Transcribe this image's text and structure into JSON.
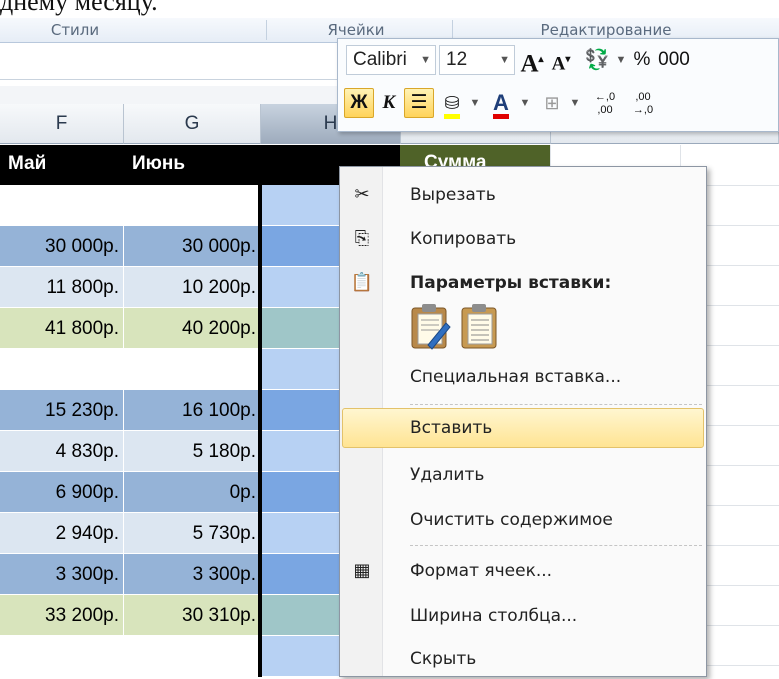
{
  "top_text": "днему месяцу.",
  "ribbon": {
    "groups": [
      "Стили",
      "Ячейки",
      "Редактирование"
    ]
  },
  "columns": [
    "F",
    "G",
    "H"
  ],
  "table_header": {
    "F": "Май",
    "G": "Июнь",
    "I": "Сумма"
  },
  "rows": [
    {
      "f": "",
      "g": "",
      "bg": "#ffffff",
      "hbg": "#b7d1f3"
    },
    {
      "f": "30 000р.",
      "g": "30 000р.",
      "bg": "#95b3d7",
      "hbg": "#7aa6e2"
    },
    {
      "f": "11 800р.",
      "g": "10 200р.",
      "bg": "#dce6f1",
      "hbg": "#b7d1f3"
    },
    {
      "f": "41 800р.",
      "g": "40 200р.",
      "bg": "#d8e4bc",
      "hbg": "#9fc6c8"
    },
    {
      "f": "",
      "g": "",
      "bg": "#ffffff",
      "hbg": "#b7d1f3"
    },
    {
      "f": "15 230р.",
      "g": "16 100р.",
      "bg": "#95b3d7",
      "hbg": "#7aa6e2"
    },
    {
      "f": "4 830р.",
      "g": "5 180р.",
      "bg": "#dce6f1",
      "hbg": "#b7d1f3"
    },
    {
      "f": "6 900р.",
      "g": "0р.",
      "bg": "#95b3d7",
      "hbg": "#7aa6e2"
    },
    {
      "f": "2 940р.",
      "g": "5 730р.",
      "bg": "#dce6f1",
      "hbg": "#b7d1f3"
    },
    {
      "f": "3 300р.",
      "g": "3 300р.",
      "bg": "#95b3d7",
      "hbg": "#7aa6e2"
    },
    {
      "f": "33 200р.",
      "g": "30 310р.",
      "bg": "#d8e4bc",
      "hbg": "#9fc6c8"
    },
    {
      "f": "",
      "g": "",
      "bg": "#ffffff",
      "hbg": "#b7d1f3"
    }
  ],
  "mini_toolbar": {
    "font": "Calibri",
    "size": "12",
    "bold": "Ж",
    "italic": "К",
    "grow": "A",
    "shrink": "A",
    "percent": "%",
    "thousands": "000",
    "inc_decimal": "←,0 ,00",
    "dec_decimal": ",00 →,0",
    "font_color": "A"
  },
  "menu": {
    "cut": "Вырезать",
    "copy": "Копировать",
    "paste_options": "Параметры вставки:",
    "paste_special": "Специальная вставка...",
    "insert": "Вставить",
    "delete": "Удалить",
    "clear": "Очистить содержимое",
    "format": "Формат ячеек...",
    "width": "Ширина столбца...",
    "hide": "Скрыть"
  }
}
